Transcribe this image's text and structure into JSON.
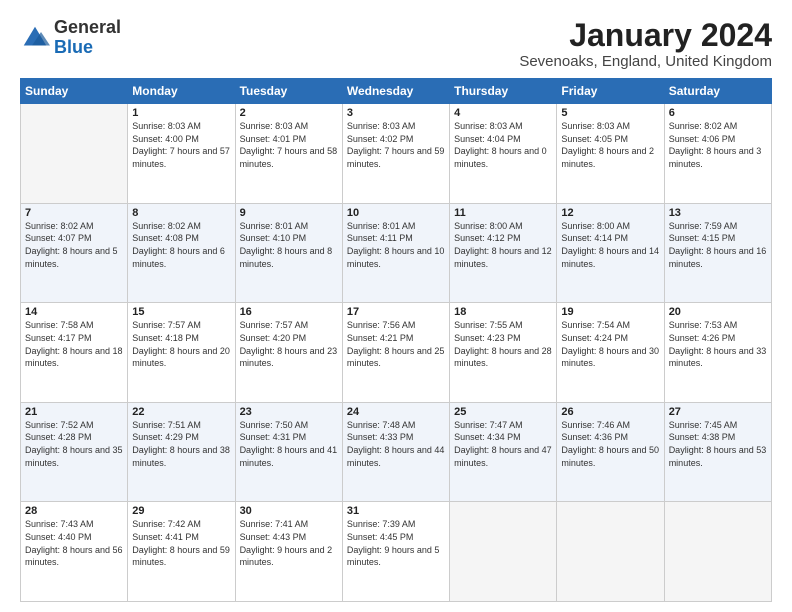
{
  "header": {
    "logo_general": "General",
    "logo_blue": "Blue",
    "month_title": "January 2024",
    "location": "Sevenoaks, England, United Kingdom"
  },
  "weekdays": [
    "Sunday",
    "Monday",
    "Tuesday",
    "Wednesday",
    "Thursday",
    "Friday",
    "Saturday"
  ],
  "weeks": [
    [
      {
        "day": "",
        "sunrise": "",
        "sunset": "",
        "daylight": ""
      },
      {
        "day": "1",
        "sunrise": "Sunrise: 8:03 AM",
        "sunset": "Sunset: 4:00 PM",
        "daylight": "Daylight: 7 hours and 57 minutes."
      },
      {
        "day": "2",
        "sunrise": "Sunrise: 8:03 AM",
        "sunset": "Sunset: 4:01 PM",
        "daylight": "Daylight: 7 hours and 58 minutes."
      },
      {
        "day": "3",
        "sunrise": "Sunrise: 8:03 AM",
        "sunset": "Sunset: 4:02 PM",
        "daylight": "Daylight: 7 hours and 59 minutes."
      },
      {
        "day": "4",
        "sunrise": "Sunrise: 8:03 AM",
        "sunset": "Sunset: 4:04 PM",
        "daylight": "Daylight: 8 hours and 0 minutes."
      },
      {
        "day": "5",
        "sunrise": "Sunrise: 8:03 AM",
        "sunset": "Sunset: 4:05 PM",
        "daylight": "Daylight: 8 hours and 2 minutes."
      },
      {
        "day": "6",
        "sunrise": "Sunrise: 8:02 AM",
        "sunset": "Sunset: 4:06 PM",
        "daylight": "Daylight: 8 hours and 3 minutes."
      }
    ],
    [
      {
        "day": "7",
        "sunrise": "Sunrise: 8:02 AM",
        "sunset": "Sunset: 4:07 PM",
        "daylight": "Daylight: 8 hours and 5 minutes."
      },
      {
        "day": "8",
        "sunrise": "Sunrise: 8:02 AM",
        "sunset": "Sunset: 4:08 PM",
        "daylight": "Daylight: 8 hours and 6 minutes."
      },
      {
        "day": "9",
        "sunrise": "Sunrise: 8:01 AM",
        "sunset": "Sunset: 4:10 PM",
        "daylight": "Daylight: 8 hours and 8 minutes."
      },
      {
        "day": "10",
        "sunrise": "Sunrise: 8:01 AM",
        "sunset": "Sunset: 4:11 PM",
        "daylight": "Daylight: 8 hours and 10 minutes."
      },
      {
        "day": "11",
        "sunrise": "Sunrise: 8:00 AM",
        "sunset": "Sunset: 4:12 PM",
        "daylight": "Daylight: 8 hours and 12 minutes."
      },
      {
        "day": "12",
        "sunrise": "Sunrise: 8:00 AM",
        "sunset": "Sunset: 4:14 PM",
        "daylight": "Daylight: 8 hours and 14 minutes."
      },
      {
        "day": "13",
        "sunrise": "Sunrise: 7:59 AM",
        "sunset": "Sunset: 4:15 PM",
        "daylight": "Daylight: 8 hours and 16 minutes."
      }
    ],
    [
      {
        "day": "14",
        "sunrise": "Sunrise: 7:58 AM",
        "sunset": "Sunset: 4:17 PM",
        "daylight": "Daylight: 8 hours and 18 minutes."
      },
      {
        "day": "15",
        "sunrise": "Sunrise: 7:57 AM",
        "sunset": "Sunset: 4:18 PM",
        "daylight": "Daylight: 8 hours and 20 minutes."
      },
      {
        "day": "16",
        "sunrise": "Sunrise: 7:57 AM",
        "sunset": "Sunset: 4:20 PM",
        "daylight": "Daylight: 8 hours and 23 minutes."
      },
      {
        "day": "17",
        "sunrise": "Sunrise: 7:56 AM",
        "sunset": "Sunset: 4:21 PM",
        "daylight": "Daylight: 8 hours and 25 minutes."
      },
      {
        "day": "18",
        "sunrise": "Sunrise: 7:55 AM",
        "sunset": "Sunset: 4:23 PM",
        "daylight": "Daylight: 8 hours and 28 minutes."
      },
      {
        "day": "19",
        "sunrise": "Sunrise: 7:54 AM",
        "sunset": "Sunset: 4:24 PM",
        "daylight": "Daylight: 8 hours and 30 minutes."
      },
      {
        "day": "20",
        "sunrise": "Sunrise: 7:53 AM",
        "sunset": "Sunset: 4:26 PM",
        "daylight": "Daylight: 8 hours and 33 minutes."
      }
    ],
    [
      {
        "day": "21",
        "sunrise": "Sunrise: 7:52 AM",
        "sunset": "Sunset: 4:28 PM",
        "daylight": "Daylight: 8 hours and 35 minutes."
      },
      {
        "day": "22",
        "sunrise": "Sunrise: 7:51 AM",
        "sunset": "Sunset: 4:29 PM",
        "daylight": "Daylight: 8 hours and 38 minutes."
      },
      {
        "day": "23",
        "sunrise": "Sunrise: 7:50 AM",
        "sunset": "Sunset: 4:31 PM",
        "daylight": "Daylight: 8 hours and 41 minutes."
      },
      {
        "day": "24",
        "sunrise": "Sunrise: 7:48 AM",
        "sunset": "Sunset: 4:33 PM",
        "daylight": "Daylight: 8 hours and 44 minutes."
      },
      {
        "day": "25",
        "sunrise": "Sunrise: 7:47 AM",
        "sunset": "Sunset: 4:34 PM",
        "daylight": "Daylight: 8 hours and 47 minutes."
      },
      {
        "day": "26",
        "sunrise": "Sunrise: 7:46 AM",
        "sunset": "Sunset: 4:36 PM",
        "daylight": "Daylight: 8 hours and 50 minutes."
      },
      {
        "day": "27",
        "sunrise": "Sunrise: 7:45 AM",
        "sunset": "Sunset: 4:38 PM",
        "daylight": "Daylight: 8 hours and 53 minutes."
      }
    ],
    [
      {
        "day": "28",
        "sunrise": "Sunrise: 7:43 AM",
        "sunset": "Sunset: 4:40 PM",
        "daylight": "Daylight: 8 hours and 56 minutes."
      },
      {
        "day": "29",
        "sunrise": "Sunrise: 7:42 AM",
        "sunset": "Sunset: 4:41 PM",
        "daylight": "Daylight: 8 hours and 59 minutes."
      },
      {
        "day": "30",
        "sunrise": "Sunrise: 7:41 AM",
        "sunset": "Sunset: 4:43 PM",
        "daylight": "Daylight: 9 hours and 2 minutes."
      },
      {
        "day": "31",
        "sunrise": "Sunrise: 7:39 AM",
        "sunset": "Sunset: 4:45 PM",
        "daylight": "Daylight: 9 hours and 5 minutes."
      },
      {
        "day": "",
        "sunrise": "",
        "sunset": "",
        "daylight": ""
      },
      {
        "day": "",
        "sunrise": "",
        "sunset": "",
        "daylight": ""
      },
      {
        "day": "",
        "sunrise": "",
        "sunset": "",
        "daylight": ""
      }
    ]
  ]
}
